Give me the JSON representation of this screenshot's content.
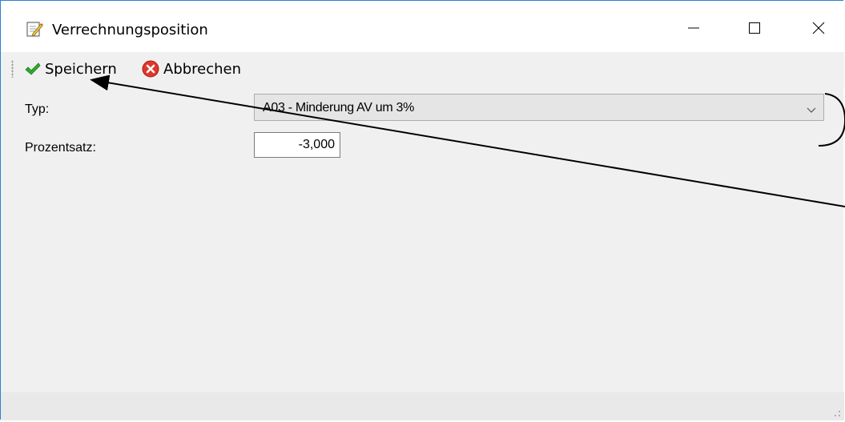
{
  "window": {
    "title": "Verrechnungsposition",
    "title_icon": "edit-document-icon"
  },
  "titlebar_buttons": {
    "minimize_icon": "minimize-icon",
    "maximize_icon": "maximize-icon",
    "close_icon": "close-icon"
  },
  "toolbar": {
    "save_label": "Speichern",
    "save_icon": "checkmark-icon",
    "cancel_label": "Abbrechen",
    "cancel_icon": "cancel-circle-icon"
  },
  "form": {
    "typ_label": "Typ:",
    "typ_value": "A03 - Minderung AV um 3%",
    "prozentsatz_label": "Prozentsatz:",
    "prozentsatz_value": "-3,000"
  },
  "colors": {
    "window_border": "#2b7fd6",
    "save_green": "#2eaa2e",
    "cancel_red": "#e0362b",
    "background": "#f0f0f0"
  }
}
